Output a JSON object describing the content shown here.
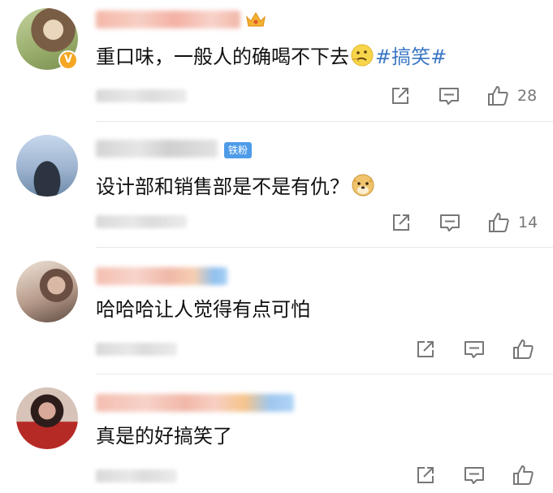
{
  "comments": [
    {
      "text": "重口味，一般人的确喝不下去",
      "hashtag": "#搞笑#",
      "likes": "28",
      "verified_badge": "V",
      "avatar_colors": [
        "#c9b79a",
        "#6d5a44",
        "#a3b46c"
      ]
    },
    {
      "text": "设计部和销售部是不是有仇？",
      "badge": "铁粉",
      "likes": "14",
      "avatar_colors": [
        "#9fb6d6",
        "#2f3a48",
        "#d9e5f2"
      ]
    },
    {
      "text": "哈哈哈让人觉得有点可怕",
      "likes": "",
      "avatar_colors": [
        "#c7a79a",
        "#4b3a32",
        "#e6d4c8"
      ]
    },
    {
      "text": "真是的好搞笑了",
      "likes": "",
      "avatar_colors": [
        "#c78b7e",
        "#301f1d",
        "#b8322e"
      ]
    }
  ],
  "icons": {
    "share": "share-icon",
    "comment": "comment-icon",
    "like": "thumbs-up-icon"
  },
  "colors": {
    "hashtag": "#3b77c4",
    "verified": "#f5a623",
    "iron_badge": "#4e9ce8",
    "icon_gray": "#777777"
  }
}
